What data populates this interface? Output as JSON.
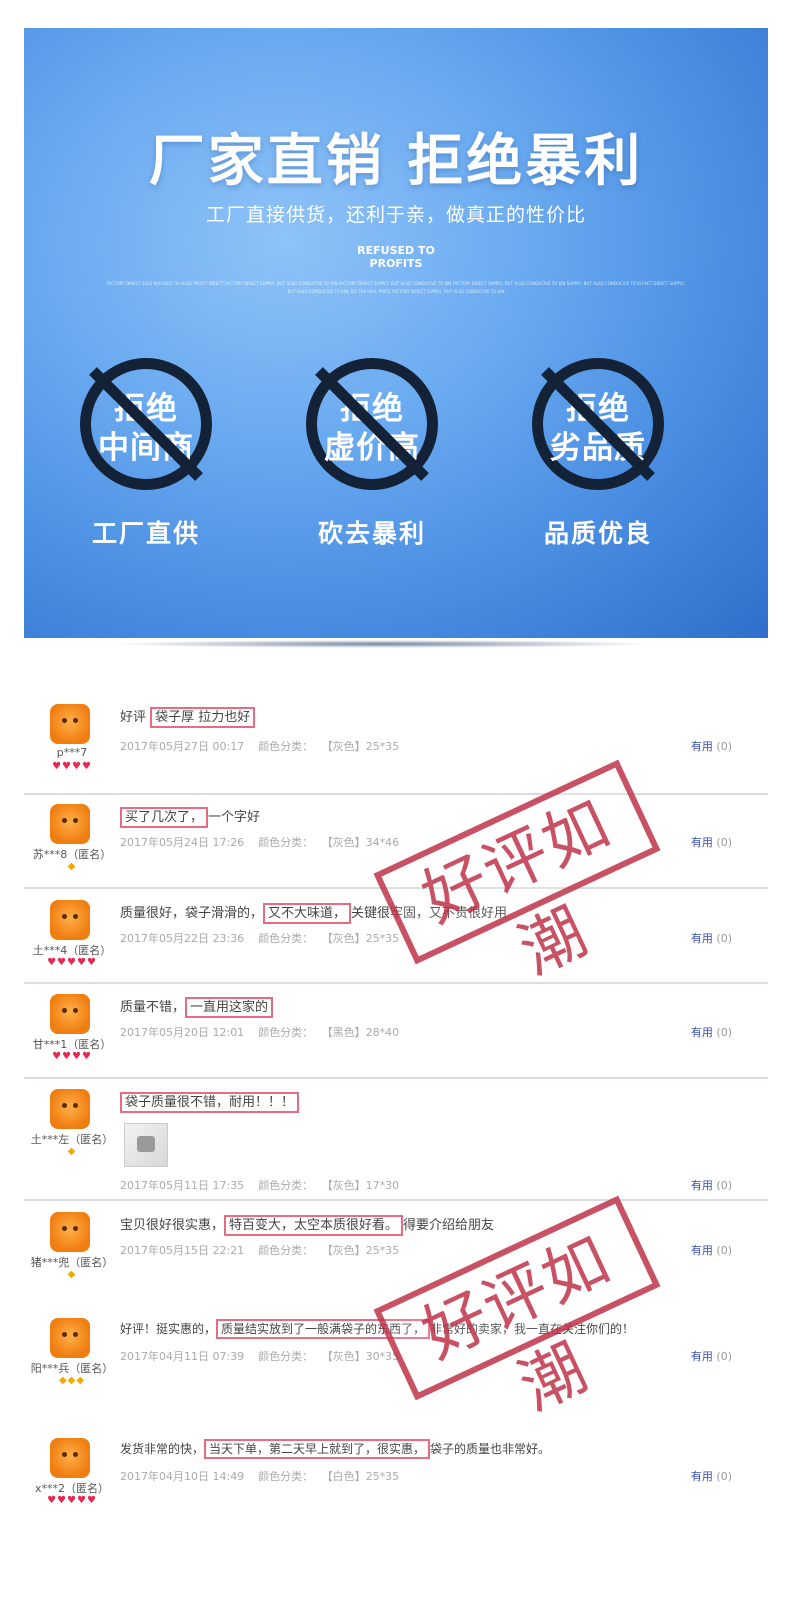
{
  "banner": {
    "headline": "厂家直销 拒绝暴利",
    "subhead": "工厂直接供货，还利于亲，做真正的性价比",
    "badge_line1": "REFUSED TO",
    "badge_line2": "PROFITS",
    "tiny_text": "FACTORY DIRECT SALE REFUSED TO HUGE PROFIT DIRECT FACTORY DIRECT SUPPLY, BUT ALSO CONDUCIVE TO KIN FACTORY DIRECT SUPPLY, BUT ALSO CONDUCIVE TO KIN FACTORY DIRECT SUPPLY, BUT ALSO CONDUCIVE TO KIN SUPPLY, BUT ALSO CONDUCIVE TO KI FACT DIRECT SUPPLY, BUT ALSO CONDUCIVE TO KIN, DO THE REAL PRICE FACTORY DIRECT SUPPLY, BUT ALSO CONDUCIVE TO KIN",
    "features": [
      {
        "line1": "拒绝",
        "line2": "中间商",
        "label": "工厂直供"
      },
      {
        "line1": "拒绝",
        "line2": "虚价高",
        "label": "砍去暴利"
      },
      {
        "line1": "拒绝",
        "line2": "劣品质",
        "label": "品质优良"
      }
    ]
  },
  "useful_label": "有用",
  "useful_count": "(0)",
  "color_prefix": "颜色分类：",
  "reviews": [
    {
      "user": "p***7",
      "rank": "♥♥♥♥",
      "pre": "好评 ",
      "hl": "袋子厚 拉力也好",
      "post": "",
      "date": "2017年05月27日 00:17",
      "color": "【灰色】25*35"
    },
    {
      "user": "苏***8（匿名）",
      "rank": "◆",
      "pre": "",
      "hl": "买了几次了，",
      "post": "一个字好",
      "date": "2017年05月24日 17:26",
      "color": "【灰色】34*46"
    },
    {
      "user": "土***4（匿名）",
      "rank": "♥♥♥♥♥",
      "pre": "质量很好，袋子滑滑的，",
      "hl": "又不大味道，",
      "post": "关键很牢固，又不贵很好用",
      "date": "2017年05月22日 23:36",
      "color": "【灰色】25*35"
    },
    {
      "user": "甘***1（匿名）",
      "rank": "♥♥♥♥",
      "pre": "质量不错，",
      "hl": "一直用这家的",
      "post": "",
      "date": "2017年05月20日 12:01",
      "color": "【黑色】28*40"
    },
    {
      "user": "土***左（匿名）",
      "rank": "◆",
      "pre": "",
      "hl": "袋子质量很不错，耐用！！！",
      "post": "",
      "date": "2017年05月11日 17:35",
      "color": "【灰色】17*30"
    },
    {
      "user": "猪***兜（匿名）",
      "rank": "◆",
      "pre": "宝贝很好很实惠，",
      "hl": "特百变大，太空本质很好看。",
      "post": "得要介绍给朋友",
      "date": "2017年05月15日 22:21",
      "color": "【灰色】25*35"
    },
    {
      "user": "阳***兵（匿名）",
      "rank": "◆◆◆",
      "pre": "好评！挺实惠的，",
      "hl": "质量结实放到了一般满袋子的东西了，",
      "post": "非常好的卖家，我一直在关注你们的！",
      "date": "2017年04月11日 07:39",
      "color": "【灰色】30*35"
    },
    {
      "user": "x***2（匿名）",
      "rank": "♥♥♥♥♥",
      "pre": "发货非常的快，",
      "hl": "当天下单，第二天早上就到了，很实惠，",
      "post": "袋子的质量也非常好。",
      "date": "2017年04月10日 14:49",
      "color": "【白色】25*35"
    }
  ],
  "stamps": [
    "好评如潮",
    "好评如潮"
  ]
}
